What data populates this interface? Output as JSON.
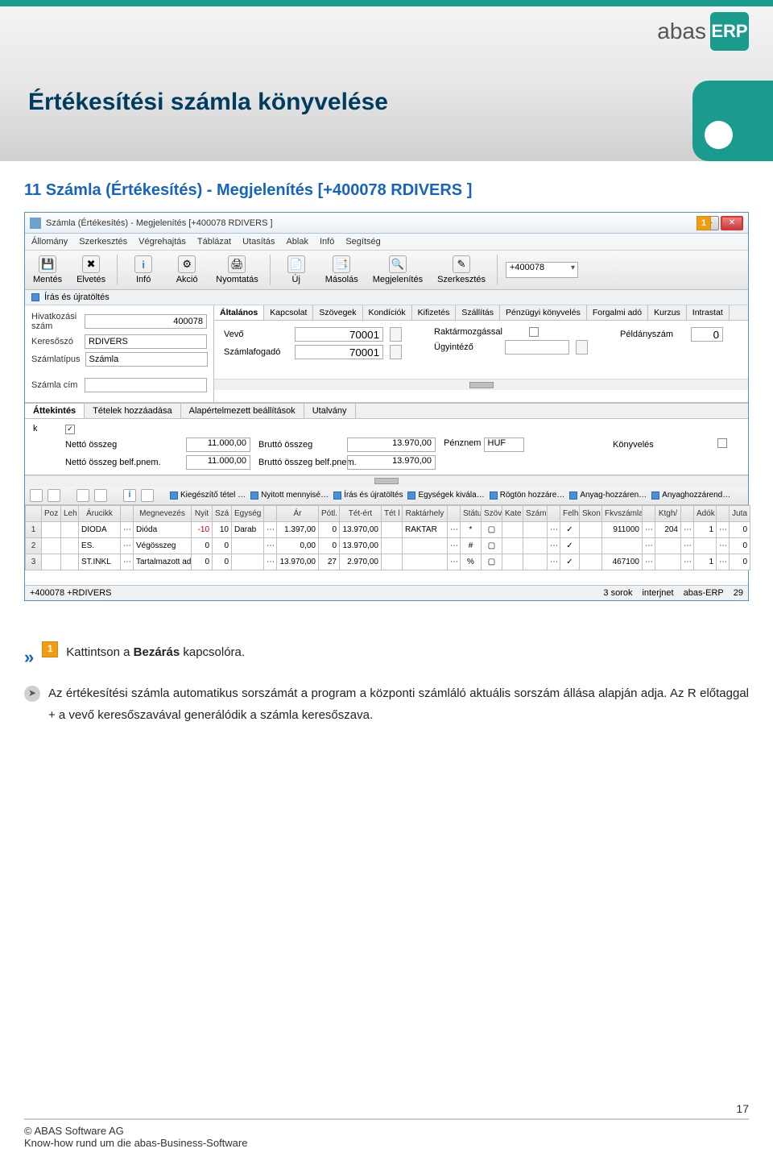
{
  "brand": {
    "name": "abas",
    "product": "ERP"
  },
  "section_title": "Értékesítési számla könyvelése",
  "breadcrumb": "11 Számla (Értékesítés) - Megjelenítés  [+400078   RDIVERS   ]",
  "window": {
    "title": "Számla (Értékesítés) - Megjelenítés [+400078  RDIVERS  ]",
    "callout": "1",
    "menubar": [
      "Állomány",
      "Szerkesztés",
      "Végrehajtás",
      "Táblázat",
      "Utasítás",
      "Ablak",
      "Infó",
      "Segítség"
    ],
    "toolbar": [
      {
        "label": "Mentés",
        "glyph": "💾"
      },
      {
        "label": "Elvetés",
        "glyph": "✖"
      },
      {
        "label": "Infó",
        "glyph": "i"
      },
      {
        "label": "Akció",
        "glyph": "⚙"
      },
      {
        "label": "Nyomtatás",
        "glyph": "🖨"
      },
      {
        "label": "Új",
        "glyph": "📄"
      },
      {
        "label": "Másolás",
        "glyph": "📑"
      },
      {
        "label": "Megjelenítés",
        "glyph": "🔍"
      },
      {
        "label": "Szerkesztés",
        "glyph": "✎"
      }
    ],
    "toolbar_input": "+400078",
    "subbar_label": "Írás és újratöltés",
    "left_form": {
      "ref_no_label": "Hivatkozási szám",
      "ref_no": "400078",
      "search_label": "Keresőszó",
      "search": "RDIVERS",
      "type_label": "Számlatípus",
      "type": "Számla",
      "title_label": "Számla cím",
      "title": ""
    },
    "inner_tabs": [
      "Általános",
      "Kapcsolat",
      "Szövegek",
      "Kondíciók",
      "Kifizetés",
      "Szállítás",
      "Pénzügyi könyvelés",
      "Forgalmi adó",
      "Kurzus",
      "Intrastat"
    ],
    "inner_body": {
      "vevo_label": "Vevő",
      "vevo": "70001",
      "szamlafogado_label": "Számlafogadó",
      "szamlafogado": "70001",
      "raktar_label": "Raktármozgással",
      "ugyintezo_label": "Ügyintéző",
      "peldany_label": "Példányszám",
      "peldany": "0"
    },
    "lower_tabs": [
      "Áttekintés",
      "Tételek hozzáadása",
      "Alapértelmezett beállítások",
      "Utalvány"
    ],
    "summary": {
      "k_label": "k",
      "netto_label": "Nettó összeg",
      "netto": "11.000,00",
      "brutto_label": "Bruttó összeg",
      "brutto": "13.970,00",
      "penznem_label": "Pénznem",
      "penznem": "HUF",
      "konyveles_label": "Könyvelés",
      "netto_belf_label": "Nettó összeg belf.pnem.",
      "netto_belf": "11.000,00",
      "brutto_belf_label": "Bruttó összeg belf.pnem.",
      "brutto_belf": "13.970,00"
    },
    "tb2": [
      "Kiegészítő tétel …",
      "Nyitott mennyisé…",
      "Írás és újratöltés",
      "Egységek kivála…",
      "Rögtön hozzáre…",
      "Anyag-hozzáren…",
      "Anyaghozzárend…"
    ],
    "grid": {
      "headers": [
        "Poz",
        "Leh",
        "Árucikk",
        "",
        "Megnevezés",
        "Nyit",
        "Szá",
        "Egység",
        "",
        "Ár",
        "Pótl.",
        "Tét-ért",
        "Tét l",
        "Raktárhely",
        "",
        "Státu",
        "Szöv",
        "Kate",
        "Szám",
        "",
        "Felh",
        "Skon",
        "Fkvszámla",
        "",
        "Ktgh/",
        "",
        "Adók",
        "",
        "Juta"
      ],
      "rows": [
        {
          "n": "1",
          "aru": "DIODA",
          "meg": "Dióda",
          "nyit": "-10",
          "sza": "10",
          "egy": "Darab",
          "ar": "1.397,00",
          "potl": "0",
          "tet": "13.970,00",
          "rakt": "RAKTAR",
          "stat": "*",
          "felh": "✓",
          "fkv": "911000",
          "ktgh": "204",
          "adok": "1",
          "juta": "0"
        },
        {
          "n": "2",
          "aru": "ES.",
          "meg": "Végösszeg",
          "nyit": "0",
          "sza": "0",
          "egy": "",
          "ar": "0,00",
          "potl": "0",
          "tet": "13.970,00",
          "rakt": "",
          "stat": "#",
          "felh": "✓",
          "fkv": "",
          "ktgh": "",
          "adok": "",
          "juta": "0"
        },
        {
          "n": "3",
          "aru": "ST.INKL",
          "meg": "Tartalmazott adó",
          "nyit": "0",
          "sza": "0",
          "egy": "",
          "ar": "13.970,00",
          "potl": "27",
          "tet": "2.970,00",
          "rakt": "",
          "stat": "%",
          "felh": "✓",
          "fkv": "467100",
          "ktgh": "",
          "adok": "1",
          "juta": "0"
        }
      ]
    },
    "statusbar": {
      "left": "+400078 +RDIVERS",
      "rows": "3 sorok",
      "host": "interjnet",
      "app": "abas-ERP",
      "num": "29"
    }
  },
  "instructions": {
    "step1_prefix": "Kattintson  a ",
    "step1_bold": "Bezárás",
    "step1_suffix": "  kapcsolóra.",
    "para": "Az értékesítési számla automatikus sorszámát a program a központi számláló aktuális sorszám állása alapján adja. Az R előtaggal + a vevő keresőszavával generálódik a számla keresőszava."
  },
  "footer": {
    "copyright": "© ABAS Software AG",
    "tagline": "Know-how  rund  um  die  abas-Business-Software",
    "page": "17"
  }
}
